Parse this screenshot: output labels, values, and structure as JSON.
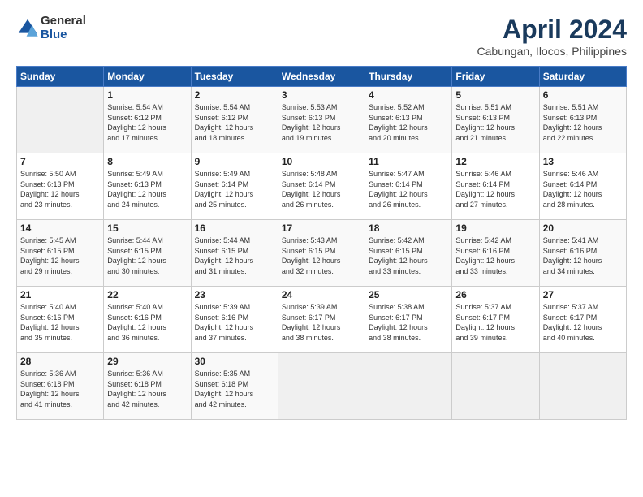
{
  "header": {
    "logo_general": "General",
    "logo_blue": "Blue",
    "month_title": "April 2024",
    "subtitle": "Cabungan, Ilocos, Philippines"
  },
  "weekdays": [
    "Sunday",
    "Monday",
    "Tuesday",
    "Wednesday",
    "Thursday",
    "Friday",
    "Saturday"
  ],
  "rows": [
    [
      {
        "day": "",
        "info": ""
      },
      {
        "day": "1",
        "info": "Sunrise: 5:54 AM\nSunset: 6:12 PM\nDaylight: 12 hours\nand 17 minutes."
      },
      {
        "day": "2",
        "info": "Sunrise: 5:54 AM\nSunset: 6:12 PM\nDaylight: 12 hours\nand 18 minutes."
      },
      {
        "day": "3",
        "info": "Sunrise: 5:53 AM\nSunset: 6:13 PM\nDaylight: 12 hours\nand 19 minutes."
      },
      {
        "day": "4",
        "info": "Sunrise: 5:52 AM\nSunset: 6:13 PM\nDaylight: 12 hours\nand 20 minutes."
      },
      {
        "day": "5",
        "info": "Sunrise: 5:51 AM\nSunset: 6:13 PM\nDaylight: 12 hours\nand 21 minutes."
      },
      {
        "day": "6",
        "info": "Sunrise: 5:51 AM\nSunset: 6:13 PM\nDaylight: 12 hours\nand 22 minutes."
      }
    ],
    [
      {
        "day": "7",
        "info": "Sunrise: 5:50 AM\nSunset: 6:13 PM\nDaylight: 12 hours\nand 23 minutes."
      },
      {
        "day": "8",
        "info": "Sunrise: 5:49 AM\nSunset: 6:13 PM\nDaylight: 12 hours\nand 24 minutes."
      },
      {
        "day": "9",
        "info": "Sunrise: 5:49 AM\nSunset: 6:14 PM\nDaylight: 12 hours\nand 25 minutes."
      },
      {
        "day": "10",
        "info": "Sunrise: 5:48 AM\nSunset: 6:14 PM\nDaylight: 12 hours\nand 26 minutes."
      },
      {
        "day": "11",
        "info": "Sunrise: 5:47 AM\nSunset: 6:14 PM\nDaylight: 12 hours\nand 26 minutes."
      },
      {
        "day": "12",
        "info": "Sunrise: 5:46 AM\nSunset: 6:14 PM\nDaylight: 12 hours\nand 27 minutes."
      },
      {
        "day": "13",
        "info": "Sunrise: 5:46 AM\nSunset: 6:14 PM\nDaylight: 12 hours\nand 28 minutes."
      }
    ],
    [
      {
        "day": "14",
        "info": "Sunrise: 5:45 AM\nSunset: 6:15 PM\nDaylight: 12 hours\nand 29 minutes."
      },
      {
        "day": "15",
        "info": "Sunrise: 5:44 AM\nSunset: 6:15 PM\nDaylight: 12 hours\nand 30 minutes."
      },
      {
        "day": "16",
        "info": "Sunrise: 5:44 AM\nSunset: 6:15 PM\nDaylight: 12 hours\nand 31 minutes."
      },
      {
        "day": "17",
        "info": "Sunrise: 5:43 AM\nSunset: 6:15 PM\nDaylight: 12 hours\nand 32 minutes."
      },
      {
        "day": "18",
        "info": "Sunrise: 5:42 AM\nSunset: 6:15 PM\nDaylight: 12 hours\nand 33 minutes."
      },
      {
        "day": "19",
        "info": "Sunrise: 5:42 AM\nSunset: 6:16 PM\nDaylight: 12 hours\nand 33 minutes."
      },
      {
        "day": "20",
        "info": "Sunrise: 5:41 AM\nSunset: 6:16 PM\nDaylight: 12 hours\nand 34 minutes."
      }
    ],
    [
      {
        "day": "21",
        "info": "Sunrise: 5:40 AM\nSunset: 6:16 PM\nDaylight: 12 hours\nand 35 minutes."
      },
      {
        "day": "22",
        "info": "Sunrise: 5:40 AM\nSunset: 6:16 PM\nDaylight: 12 hours\nand 36 minutes."
      },
      {
        "day": "23",
        "info": "Sunrise: 5:39 AM\nSunset: 6:16 PM\nDaylight: 12 hours\nand 37 minutes."
      },
      {
        "day": "24",
        "info": "Sunrise: 5:39 AM\nSunset: 6:17 PM\nDaylight: 12 hours\nand 38 minutes."
      },
      {
        "day": "25",
        "info": "Sunrise: 5:38 AM\nSunset: 6:17 PM\nDaylight: 12 hours\nand 38 minutes."
      },
      {
        "day": "26",
        "info": "Sunrise: 5:37 AM\nSunset: 6:17 PM\nDaylight: 12 hours\nand 39 minutes."
      },
      {
        "day": "27",
        "info": "Sunrise: 5:37 AM\nSunset: 6:17 PM\nDaylight: 12 hours\nand 40 minutes."
      }
    ],
    [
      {
        "day": "28",
        "info": "Sunrise: 5:36 AM\nSunset: 6:18 PM\nDaylight: 12 hours\nand 41 minutes."
      },
      {
        "day": "29",
        "info": "Sunrise: 5:36 AM\nSunset: 6:18 PM\nDaylight: 12 hours\nand 42 minutes."
      },
      {
        "day": "30",
        "info": "Sunrise: 5:35 AM\nSunset: 6:18 PM\nDaylight: 12 hours\nand 42 minutes."
      },
      {
        "day": "",
        "info": ""
      },
      {
        "day": "",
        "info": ""
      },
      {
        "day": "",
        "info": ""
      },
      {
        "day": "",
        "info": ""
      }
    ]
  ]
}
